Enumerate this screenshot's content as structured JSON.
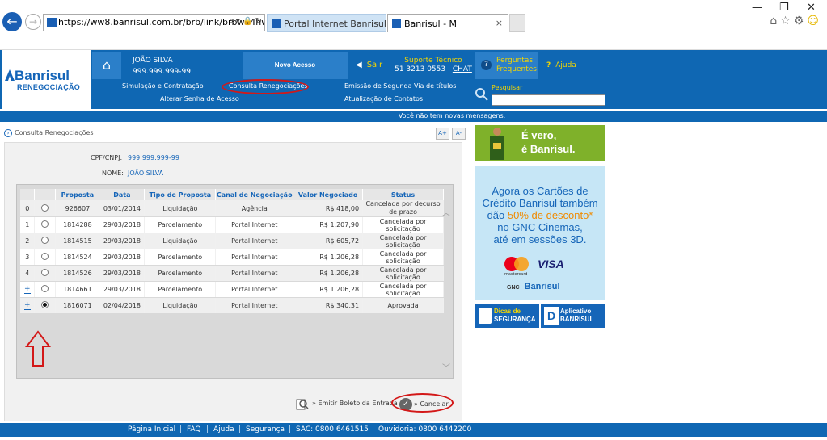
{
  "browser": {
    "url": "https://ww8.banrisul.com.br/brb/link/brbwe4hw.as",
    "url_icons": "⌕ ▾ 🔒 ↻",
    "tabs": [
      {
        "label": "Portal Internet Banrisul"
      },
      {
        "label": "Banrisul - M"
      }
    ],
    "tab_close": "×",
    "window_controls": {
      "minimize": "—",
      "restore": "❐",
      "close": "✕"
    }
  },
  "header": {
    "logo_name": "Banrisul",
    "logo_sub": "RENEGOCIAÇÃO",
    "user_name": "JOÃO SILVA",
    "user_doc": "999.999.999-99",
    "novo_acesso": "Novo Acesso",
    "sair": "Sair",
    "suporte_label": "Suporte Técnico",
    "suporte_phone": "51 3213 0553",
    "chat": "CHAT",
    "perguntas_line1": "Perguntas",
    "perguntas_line2": "Frequentes",
    "ajuda": "Ajuda",
    "nav": {
      "simulacao": "Simulação e Contratação",
      "consulta": "Consulta Renegociações",
      "emissao": "Emissão de Segunda Via de títulos",
      "alterar_senha": "Alterar Senha de Acesso",
      "atualizacao": "Atualização de Contatos"
    },
    "pesquisar": "Pesquisar",
    "search_placeholder": ""
  },
  "messages": "Você não tem novas mensagens.",
  "breadcrumb": "Consulta Renegociações",
  "font_buttons": {
    "increase": "A+",
    "decrease": "A-"
  },
  "client": {
    "cpf_label": "CPF/CNPJ:",
    "cpf_value": "999.999.999-99",
    "nome_label": "NOME:",
    "nome_value": "JOÃO SILVA"
  },
  "table": {
    "headers": [
      "Proposta",
      "Data",
      "Tipo de Proposta",
      "Canal de Negociação",
      "Valor Negociado",
      "Status"
    ],
    "rows": [
      {
        "idx": "0",
        "proposta": "926607",
        "data": "03/01/2014",
        "tipo": "Liquidação",
        "canal": "Agência",
        "valor": "R$ 418,00",
        "status": "Cancelada por decurso de prazo",
        "selected": false,
        "expand": false
      },
      {
        "idx": "1",
        "proposta": "1814288",
        "data": "29/03/2018",
        "tipo": "Parcelamento",
        "canal": "Portal Internet",
        "valor": "R$ 1.207,90",
        "status": "Cancelada por solicitação",
        "selected": false,
        "expand": false
      },
      {
        "idx": "2",
        "proposta": "1814515",
        "data": "29/03/2018",
        "tipo": "Liquidação",
        "canal": "Portal Internet",
        "valor": "R$ 605,72",
        "status": "Cancelada por solicitação",
        "selected": false,
        "expand": false
      },
      {
        "idx": "3",
        "proposta": "1814524",
        "data": "29/03/2018",
        "tipo": "Parcelamento",
        "canal": "Portal Internet",
        "valor": "R$ 1.206,28",
        "status": "Cancelada por solicitação",
        "selected": false,
        "expand": false
      },
      {
        "idx": "4",
        "proposta": "1814526",
        "data": "29/03/2018",
        "tipo": "Parcelamento",
        "canal": "Portal Internet",
        "valor": "R$ 1.206,28",
        "status": "Cancelada por solicitação",
        "selected": false,
        "expand": false
      },
      {
        "idx": "+",
        "proposta": "1814661",
        "data": "29/03/2018",
        "tipo": "Parcelamento",
        "canal": "Portal Internet",
        "valor": "R$ 1.206,28",
        "status": "Cancelada por solicitação",
        "selected": false,
        "expand": true
      },
      {
        "idx": "+",
        "proposta": "1816071",
        "data": "02/04/2018",
        "tipo": "Liquidação",
        "canal": "Portal Internet",
        "valor": "R$ 340,31",
        "status": "Aprovada",
        "selected": true,
        "expand": true
      }
    ]
  },
  "actions": {
    "emitir": "» Emitir Boleto da Entrada",
    "cancelar": "» Cancelar"
  },
  "footer": {
    "items": [
      "Página Inicial",
      "FAQ",
      "Ajuda",
      "Segurança",
      "SAC: 0800 6461515",
      "Ouvidoria: 0800 6442200"
    ]
  },
  "ads": {
    "vero_line1": "É vero,",
    "vero_line2": "é Banrisul.",
    "cards_text_1": "Agora os Cartões de",
    "cards_text_2": "Crédito Banrisul também",
    "cards_text_3a": "dão ",
    "cards_text_3b": "50% de desconto*",
    "cards_text_4": "no GNC Cinemas,",
    "cards_text_5": "até em sessões 3D.",
    "mastercard": "mastercard",
    "visa": "VISA",
    "gnc": "GNC",
    "banrisul": "Banrisul",
    "dicas_1": "Dicas de",
    "dicas_2": "SEGURANÇA",
    "app_1": "Aplicativo",
    "app_2": "BANRISUL",
    "app_letter": "D"
  },
  "colors": {
    "brand_blue": "#0f67b3",
    "accent_yellow": "#f4d600",
    "annotation_red": "#d31818"
  }
}
